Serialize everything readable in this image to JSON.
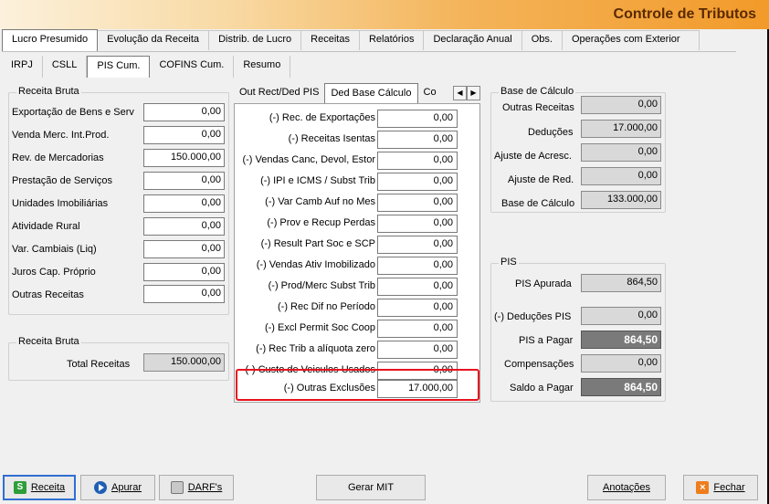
{
  "window": {
    "title": "Controle de Tributos"
  },
  "main_tabs": [
    "Lucro Presumido",
    "Evolução da Receita",
    "Distrib. de Lucro",
    "Receitas",
    "Relatórios",
    "Declaração Anual",
    "Obs.",
    "Operações com Exterior"
  ],
  "sub_tabs": [
    "IRPJ",
    "CSLL",
    "PIS Cum.",
    "COFINS Cum.",
    "Resumo"
  ],
  "receita_bruta": {
    "legend": "Receita Bruta",
    "rows": [
      {
        "label": "Exportação de Bens e Serv",
        "value": "0,00"
      },
      {
        "label": "Venda Merc. Int.Prod.",
        "value": "0,00"
      },
      {
        "label": "Rev. de Mercadorias",
        "value": "150.000,00"
      },
      {
        "label": "Prestação de Serviços",
        "value": "0,00"
      },
      {
        "label": "Unidades Imobiliárias",
        "value": "0,00"
      },
      {
        "label": "Atividade Rural",
        "value": "0,00"
      },
      {
        "label": "Var. Cambiais (Liq)",
        "value": "0,00"
      },
      {
        "label": "Juros Cap. Próprio",
        "value": "0,00"
      },
      {
        "label": "Outras Receitas",
        "value": "0,00"
      }
    ]
  },
  "receita_bruta_total": {
    "legend": "Receita Bruta",
    "label": "Total Receitas",
    "value": "150.000,00"
  },
  "mid_tabs": [
    "Out Rect/Ded PIS",
    "Ded Base Cálculo",
    "Co"
  ],
  "deductions": [
    {
      "label": "(-) Rec. de Exportações",
      "value": "0,00"
    },
    {
      "label": "(-) Receitas Isentas",
      "value": "0,00"
    },
    {
      "label": "(-) Vendas Canc, Devol, Estor",
      "value": "0,00"
    },
    {
      "label": "(-) IPI e ICMS / Subst Trib",
      "value": "0,00"
    },
    {
      "label": "(-) Var Camb Auf no Mes",
      "value": "0,00"
    },
    {
      "label": "(-) Prov e Recup Perdas",
      "value": "0,00"
    },
    {
      "label": "(-) Result Part Soc e SCP",
      "value": "0,00"
    },
    {
      "label": "(-) Vendas Ativ Imobilizado",
      "value": "0,00"
    },
    {
      "label": "(-) Prod/Merc Subst Trib",
      "value": "0,00"
    },
    {
      "label": "(-) Rec Dif no Período",
      "value": "0,00"
    },
    {
      "label": "(-) Excl Permit Soc Coop",
      "value": "0,00"
    },
    {
      "label": "(-) Rec Trib a alíquota zero",
      "value": "0,00"
    },
    {
      "label": "(-) Custo de Veiculos Usados",
      "value": "0,00"
    },
    {
      "label": "(-) Outras Exclusões",
      "value": "17.000,00"
    }
  ],
  "base_calculo": {
    "legend": "Base de Cálculo",
    "outras_receitas": {
      "label": "Outras Receitas",
      "value": "0,00"
    },
    "deducoes": {
      "label": "Deduções",
      "value": "17.000,00"
    },
    "ajuste_acresc": {
      "label": "Ajuste de Acresc.",
      "value": "0,00"
    },
    "ajuste_red": {
      "label": "Ajuste de Red.",
      "value": "0,00"
    },
    "base": {
      "label": "Base de Cálculo",
      "value": "133.000,00"
    }
  },
  "pis": {
    "legend": "PIS",
    "apurada": {
      "label": "PIS Apurada",
      "value": "864,50"
    },
    "deducoes": {
      "label": "(-) Deduções PIS",
      "value": "0,00"
    },
    "a_pagar": {
      "label": "PIS a Pagar",
      "value": "864,50"
    },
    "compensacoes": {
      "label": "Compensações",
      "value": "0,00"
    },
    "saldo": {
      "label": "Saldo a Pagar",
      "value": "864,50"
    }
  },
  "buttons": {
    "receita": "Receita",
    "apurar": "Apurar",
    "darfs": "DARF's",
    "gerar_mit": "Gerar MIT",
    "anotacoes": "Anotações",
    "fechar": "Fechar"
  },
  "icons": {
    "receita": "green-s-icon",
    "apurar": "blue-play-icon",
    "darfs": "printer-icon",
    "fechar": "orange-x-icon"
  }
}
